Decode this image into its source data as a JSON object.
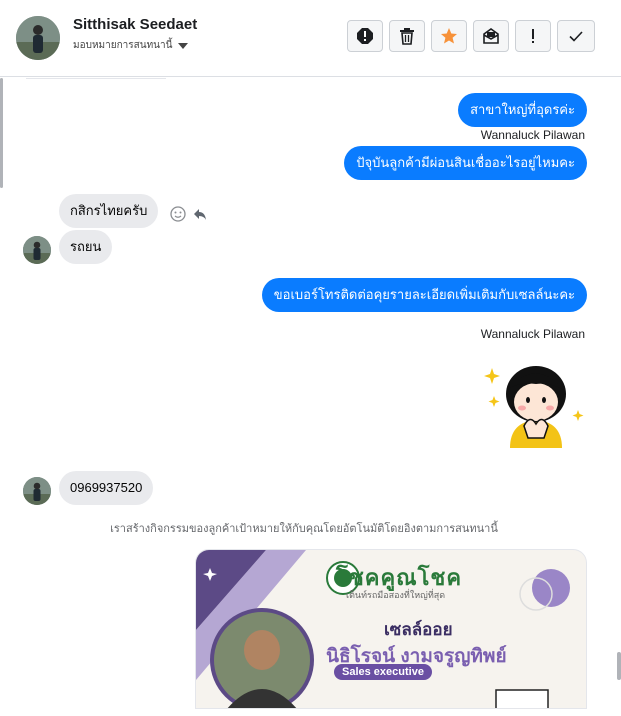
{
  "header": {
    "contact_name": "Sitthisak Seedaet",
    "assign_label": "มอบหมายการสนทนานี้",
    "toolbar": [
      {
        "name": "report-spam-button",
        "icon": "alert-octagon-icon"
      },
      {
        "name": "delete-button",
        "icon": "trash-icon"
      },
      {
        "name": "star-button",
        "icon": "star-icon"
      },
      {
        "name": "mark-unread-button",
        "icon": "envelope-open-icon"
      },
      {
        "name": "priority-button",
        "icon": "exclamation-icon"
      },
      {
        "name": "mark-done-button",
        "icon": "check-icon"
      }
    ]
  },
  "messages": [
    {
      "id": "m1",
      "direction": "out",
      "text": "สาขาใหญ่ที่อุดรค่ะ"
    },
    {
      "id": "m1s",
      "sender": "Wannaluck Pilawan"
    },
    {
      "id": "m2",
      "direction": "out",
      "text": "ปัจุบันลูกค้ามีผ่อนสินเชื่ออะไรอยู่ไหมคะ"
    },
    {
      "id": "m3",
      "direction": "in",
      "text": "กสิกรไทยครับ"
    },
    {
      "id": "m4",
      "direction": "in",
      "text": "รถยน"
    },
    {
      "id": "m5",
      "direction": "out",
      "text": "ขอเบอร์โทรติดต่อคุยรายละเอียดเพิ่มเติมกับเซลล์นะคะ"
    },
    {
      "id": "m5s",
      "sender": "Wannaluck Pilawan"
    },
    {
      "id": "m6",
      "direction": "in",
      "text": "0969937520"
    }
  ],
  "notice": "เราสร้างกิจกรรมของลูกค้าเป้าหมายให้กับคุณโดยอัตโนมัติโดยอิงตามการสนทนานี้",
  "card": {
    "brand": "โชคคูณโชค",
    "tagline": "เต็นท์รถมือสองที่ใหญ่ที่สุด",
    "role": "เซลล์ออย",
    "name": "นิธิโรจน์   งามจรูญทิพย์",
    "badge": "Sales executive"
  },
  "colors": {
    "outgoing_bubble": "#0a7cff",
    "incoming_bubble": "#e9eaed",
    "star": "#f7923a"
  }
}
